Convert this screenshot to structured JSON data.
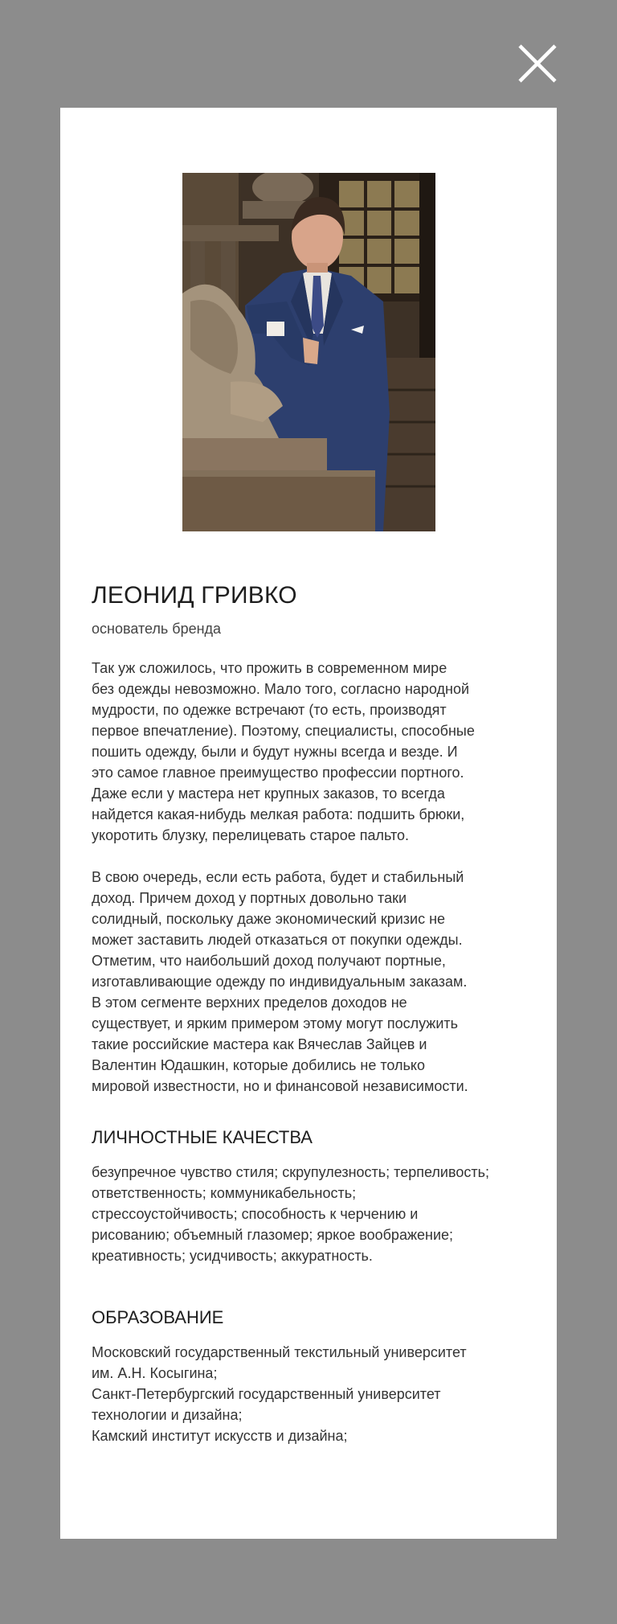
{
  "close": {
    "icon": "close-icon"
  },
  "profile": {
    "photo_alt": "Леонид Гривко",
    "name": "ЛЕОНИД ГРИВКО",
    "role": "основатель бренда",
    "paragraphs": [
      "Так уж сложилось, что прожить в современном мире\nбез одежды невозможно. Мало того, согласно народной\nмудрости, по одежке встречают (то есть, производят\nпервое впечатление). Поэтому, специалисты, способные\nпошить одежду, были и будут нужны всегда и везде. И\nэто самое главное преимущество профессии портного.\nДаже если у мастера нет крупных заказов, то всегда\nнайдется какая-нибудь мелкая работа: подшить брюки,\nукоротить блузку, перелицевать старое пальто.",
      "В свою очередь, если есть работа, будет и стабильный\nдоход. Причем доход у портных довольно таки\nсолидный, поскольку даже экономический кризис не\nможет заставить людей отказаться от покупки одежды.\nОтметим, что наибольший доход получают портные,\nизготавливающие одежду по индивидуальным заказам.\nВ этом сегменте верхних пределов доходов не\nсуществует, и ярким примером этому могут послужить\nтакие российские мастера как Вячеслав Зайцев и\nВалентин Юдашкин, которые добились не только\nмировой известности, но и финансовой независимости."
    ]
  },
  "qualities": {
    "title": "ЛИЧНОСТНЫЕ КАЧЕСТВА",
    "text": "безупречное чувство стиля; скрупулезность; терпеливость;\nответственность; коммуникабельность;\nстрессоустойчивость; способность к черчению и\nрисованию; объемный глазомер; яркое воображение;\nкреативность; усидчивость; аккуратность."
  },
  "education": {
    "title": "ОБРАЗОВАНИЕ",
    "text": "Московский государственный текстильный университет\nим. А.Н. Косыгина;\nСанкт-Петербургский государственный университет\nтехнологии и дизайна;\nКамский институт искусств и дизайна;"
  },
  "colors": {
    "overlay": "#8c8c8c",
    "modal": "#ffffff",
    "text": "#222222"
  }
}
